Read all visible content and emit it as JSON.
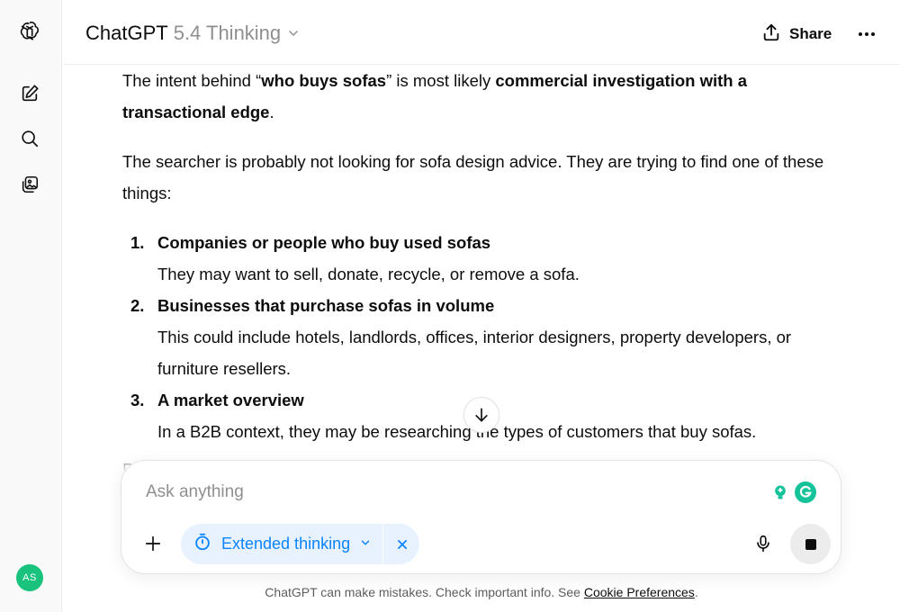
{
  "header": {
    "model_name": "ChatGPT",
    "model_version": "5.4 Thinking",
    "share_label": "Share"
  },
  "sidebar": {
    "avatar_initials": "AS"
  },
  "message": {
    "p1": {
      "pre": "The intent behind “",
      "b1": "who buys sofas",
      "mid": "” is most likely ",
      "b2": "commercial investigation with a transactional edge",
      "post": "."
    },
    "p2": "The searcher is probably not looking for sofa design advice. They are trying to find one of these things:",
    "list": [
      {
        "num": "1.",
        "title": "Companies or people who buy used sofas",
        "body": "They may want to sell, donate, recycle, or remove a sofa."
      },
      {
        "num": "2.",
        "title": "Businesses that purchase sofas in volume",
        "body": "This could include hotels, landlords, offices, interior designers, property developers, or furniture resellers."
      },
      {
        "num": "3.",
        "title": "A market overview",
        "body": "In a B2B context, they may be researching the types of customers that buy sofas."
      }
    ],
    "partial": "P"
  },
  "composer": {
    "placeholder": "Ask anything",
    "mode_label": "Extended thinking"
  },
  "footer": {
    "disclaimer": "ChatGPT can make mistakes. Check important info. See ",
    "link": "Cookie Preferences",
    "end": "."
  },
  "colors": {
    "accent": "#0a84ff",
    "avatar": "#19c37d",
    "grammarly": "#15c39a"
  }
}
